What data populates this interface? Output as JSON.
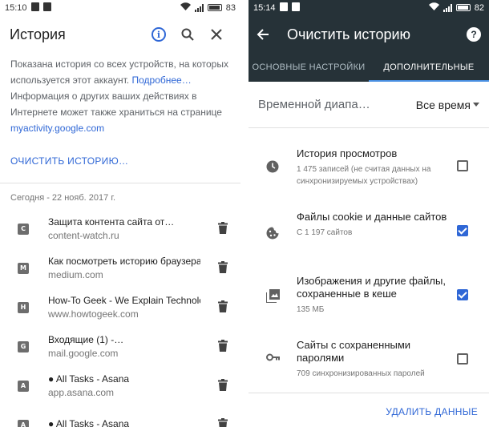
{
  "left": {
    "status": {
      "time": "15:10",
      "battery": "83"
    },
    "title": "История",
    "description": "Показана история со всех устройств, на которых используется этот аккаунт.",
    "more_link": "Подробнее…",
    "description2": "Информация о других ваших действиях в Интернете может также храниться на странице",
    "activity_link": "myactivity.google.com",
    "clear_button": "ОЧИСТИТЬ ИСТОРИЮ…",
    "date_header": "Сегодня - 22 нояб. 2017 г.",
    "items": [
      {
        "letter": "C",
        "title": "Защита контента сайта от…",
        "url": "content-watch.ru"
      },
      {
        "letter": "M",
        "title": "Как посмотреть историю браузера …",
        "url": "medium.com"
      },
      {
        "letter": "H",
        "title": "How-To Geek - We Explain Technology",
        "url": "www.howtogeek.com"
      },
      {
        "letter": "G",
        "title": "Входящие (1) -…",
        "url": "mail.google.com"
      },
      {
        "letter": "A",
        "title": "● All Tasks - Asana",
        "url": "app.asana.com"
      },
      {
        "letter": "A",
        "title": "● All Tasks - Asana",
        "url": ""
      }
    ]
  },
  "right": {
    "status": {
      "time": "15:14",
      "battery": "82"
    },
    "title": "Очистить историю",
    "tabs": [
      "ОСНОВНЫЕ НАСТРОЙКИ",
      "ДОПОЛНИТЕЛЬНЫЕ"
    ],
    "time_range_label": "Временной диапа…",
    "time_range_value": "Все время",
    "options": [
      {
        "title": "История просмотров",
        "sub": "1 475 записей (не считая данных на синхронизируемых устройствах)",
        "checked": false,
        "icon": "clock-icon"
      },
      {
        "title": "Файлы cookie и данные сайтов",
        "sub": "С 1 197 сайтов",
        "checked": true,
        "icon": "cookie-icon"
      },
      {
        "title": "Изображения и другие файлы, сохраненные в кеше",
        "sub": "135 МБ",
        "checked": true,
        "icon": "images-icon"
      },
      {
        "title": "Сайты с сохраненными паролями",
        "sub": "709 синхронизированных паролей",
        "checked": false,
        "icon": "key-icon"
      }
    ],
    "delete_button": "УДАЛИТЬ ДАННЫЕ"
  }
}
